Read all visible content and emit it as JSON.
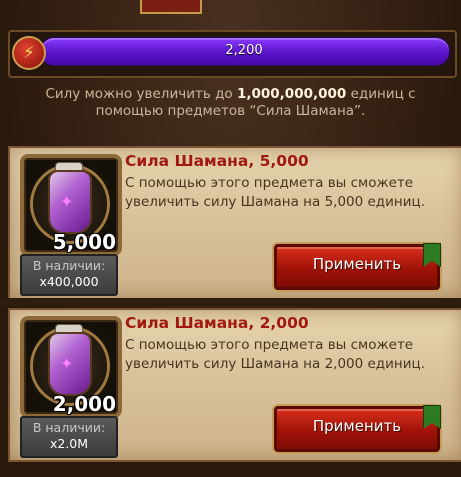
{
  "header": {
    "power_value": "2,200",
    "power_fill": 1.0,
    "info_prefix": "Силу можно увеличить до",
    "info_amount": "1,000,000,000",
    "info_suffix": "единиц с",
    "info_line2": "помощью предметов “Сила Шамана”."
  },
  "items": [
    {
      "title": "Сила Шамана, 5,000",
      "description": "С помощью этого предмета вы сможете увеличить силу Шамана на 5,000 единиц.",
      "icon_value": "5,000",
      "stock_label": "В наличии:",
      "stock_value": "x400,000",
      "button_label": "Применить"
    },
    {
      "title": "Сила Шамана, 2,000",
      "description": "С помощью этого предмета вы сможете увеличить силу Шамана на 2,000 единиц.",
      "icon_value": "2,000",
      "stock_label": "В наличии:",
      "stock_value": "x2.0M",
      "button_label": "Применить"
    }
  ],
  "colors": {
    "bar": "#5a12c8",
    "title": "#a01a10",
    "button": "#a01208"
  },
  "icons": {
    "bolt": "lightning-bolt-icon",
    "potion": "shaman-potion-icon",
    "flag": "green-flag-icon"
  }
}
